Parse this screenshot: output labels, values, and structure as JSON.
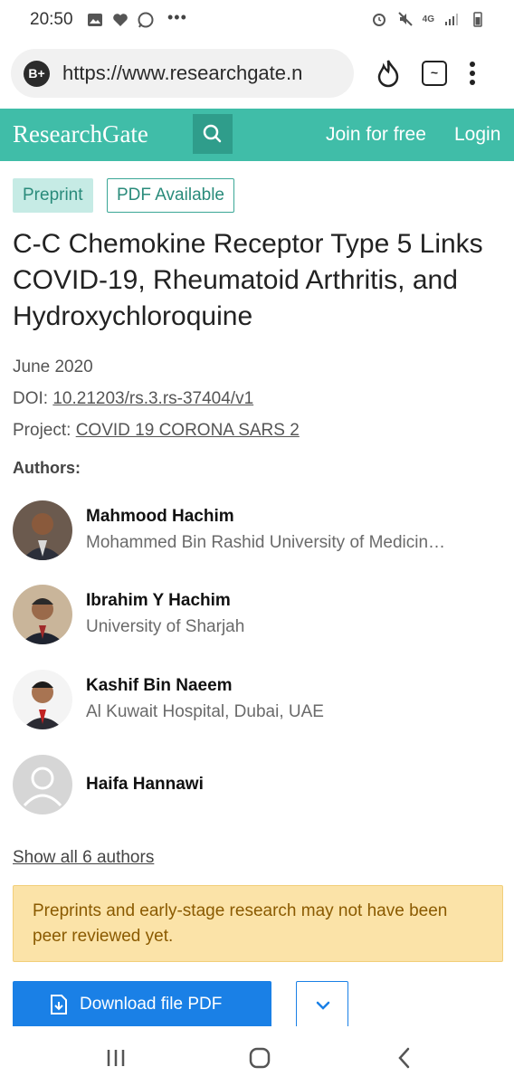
{
  "status_bar": {
    "time": "20:50",
    "network": "4G"
  },
  "browser": {
    "url": "https://www.researchgate.n",
    "badge_label": "B+",
    "tab_label": "~"
  },
  "header": {
    "logo": "ResearchGate",
    "join_label": "Join for free",
    "login_label": "Login",
    "accent_color": "#40bda8"
  },
  "badges": {
    "preprint": "Preprint",
    "pdf": "PDF Available"
  },
  "publication": {
    "title": "C-C Chemokine Receptor Type 5 Links COVID-19, Rheumatoid Arthritis, and Hydroxychloroquine",
    "date": "June 2020",
    "doi_label": "DOI:",
    "doi": "10.21203/rs.3.rs-37404/v1",
    "project_label": "Project:",
    "project": "COVID 19 CORONA SARS 2",
    "authors_label": "Authors:"
  },
  "authors": [
    {
      "name": "Mahmood Hachim",
      "institution": "Mohammed Bin Rashid University of Medicin…"
    },
    {
      "name": "Ibrahim Y Hachim",
      "institution": "University of Sharjah"
    },
    {
      "name": "Kashif Bin Naeem",
      "institution": "Al Kuwait Hospital, Dubai, UAE"
    },
    {
      "name": "Haifa Hannawi",
      "institution": ""
    }
  ],
  "show_all": "Show all 6 authors",
  "notice": "Preprints and early-stage research may not have been peer reviewed yet.",
  "download": {
    "label": "Download file PDF",
    "color": "#1a80e6"
  }
}
